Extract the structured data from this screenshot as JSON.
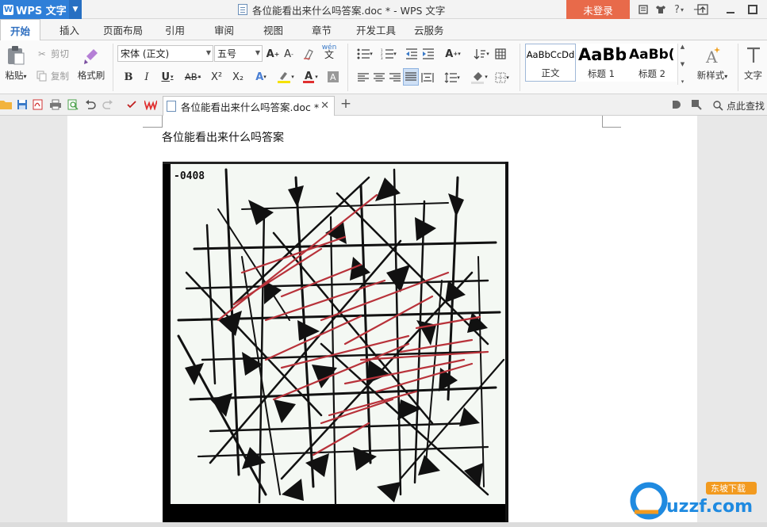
{
  "app": {
    "name": "WPS 文字"
  },
  "titlebar": {
    "document_title": "各位能看出来什么吗答案.doc * - WPS 文字",
    "login_label": "未登录"
  },
  "menu": {
    "tabs": [
      "开始",
      "插入",
      "页面布局",
      "引用",
      "审阅",
      "视图",
      "章节",
      "开发工具",
      "云服务"
    ],
    "active": "开始"
  },
  "ribbon": {
    "paste": "粘贴",
    "cut": "剪切",
    "copy": "复制",
    "format_painter": "格式刷",
    "font_name": "宋体 (正文)",
    "font_size": "五号",
    "bold": "B",
    "italic": "I",
    "underline": "U",
    "strike": "AB",
    "superscript": "X²",
    "subscript": "X₂",
    "phonetic": "wén",
    "styles": [
      {
        "preview": "AaBbCcDd",
        "label": "正文"
      },
      {
        "preview": "AaBb",
        "label": "标题 1"
      },
      {
        "preview": "AaBb(",
        "label": "标题 2"
      }
    ],
    "new_style": "新样式",
    "text_tool": "文字"
  },
  "tabbar": {
    "doc_tab": "各位能看出来什么吗答案.doc *",
    "search_label": "点此查找"
  },
  "document": {
    "paragraph": "各位能看出来什么吗答案",
    "image_label": "-0408"
  },
  "watermark": {
    "text": "uzzf.com",
    "badge": "东坡下载"
  },
  "colors": {
    "accent": "#2f7fd8",
    "login": "#e86a4a"
  }
}
